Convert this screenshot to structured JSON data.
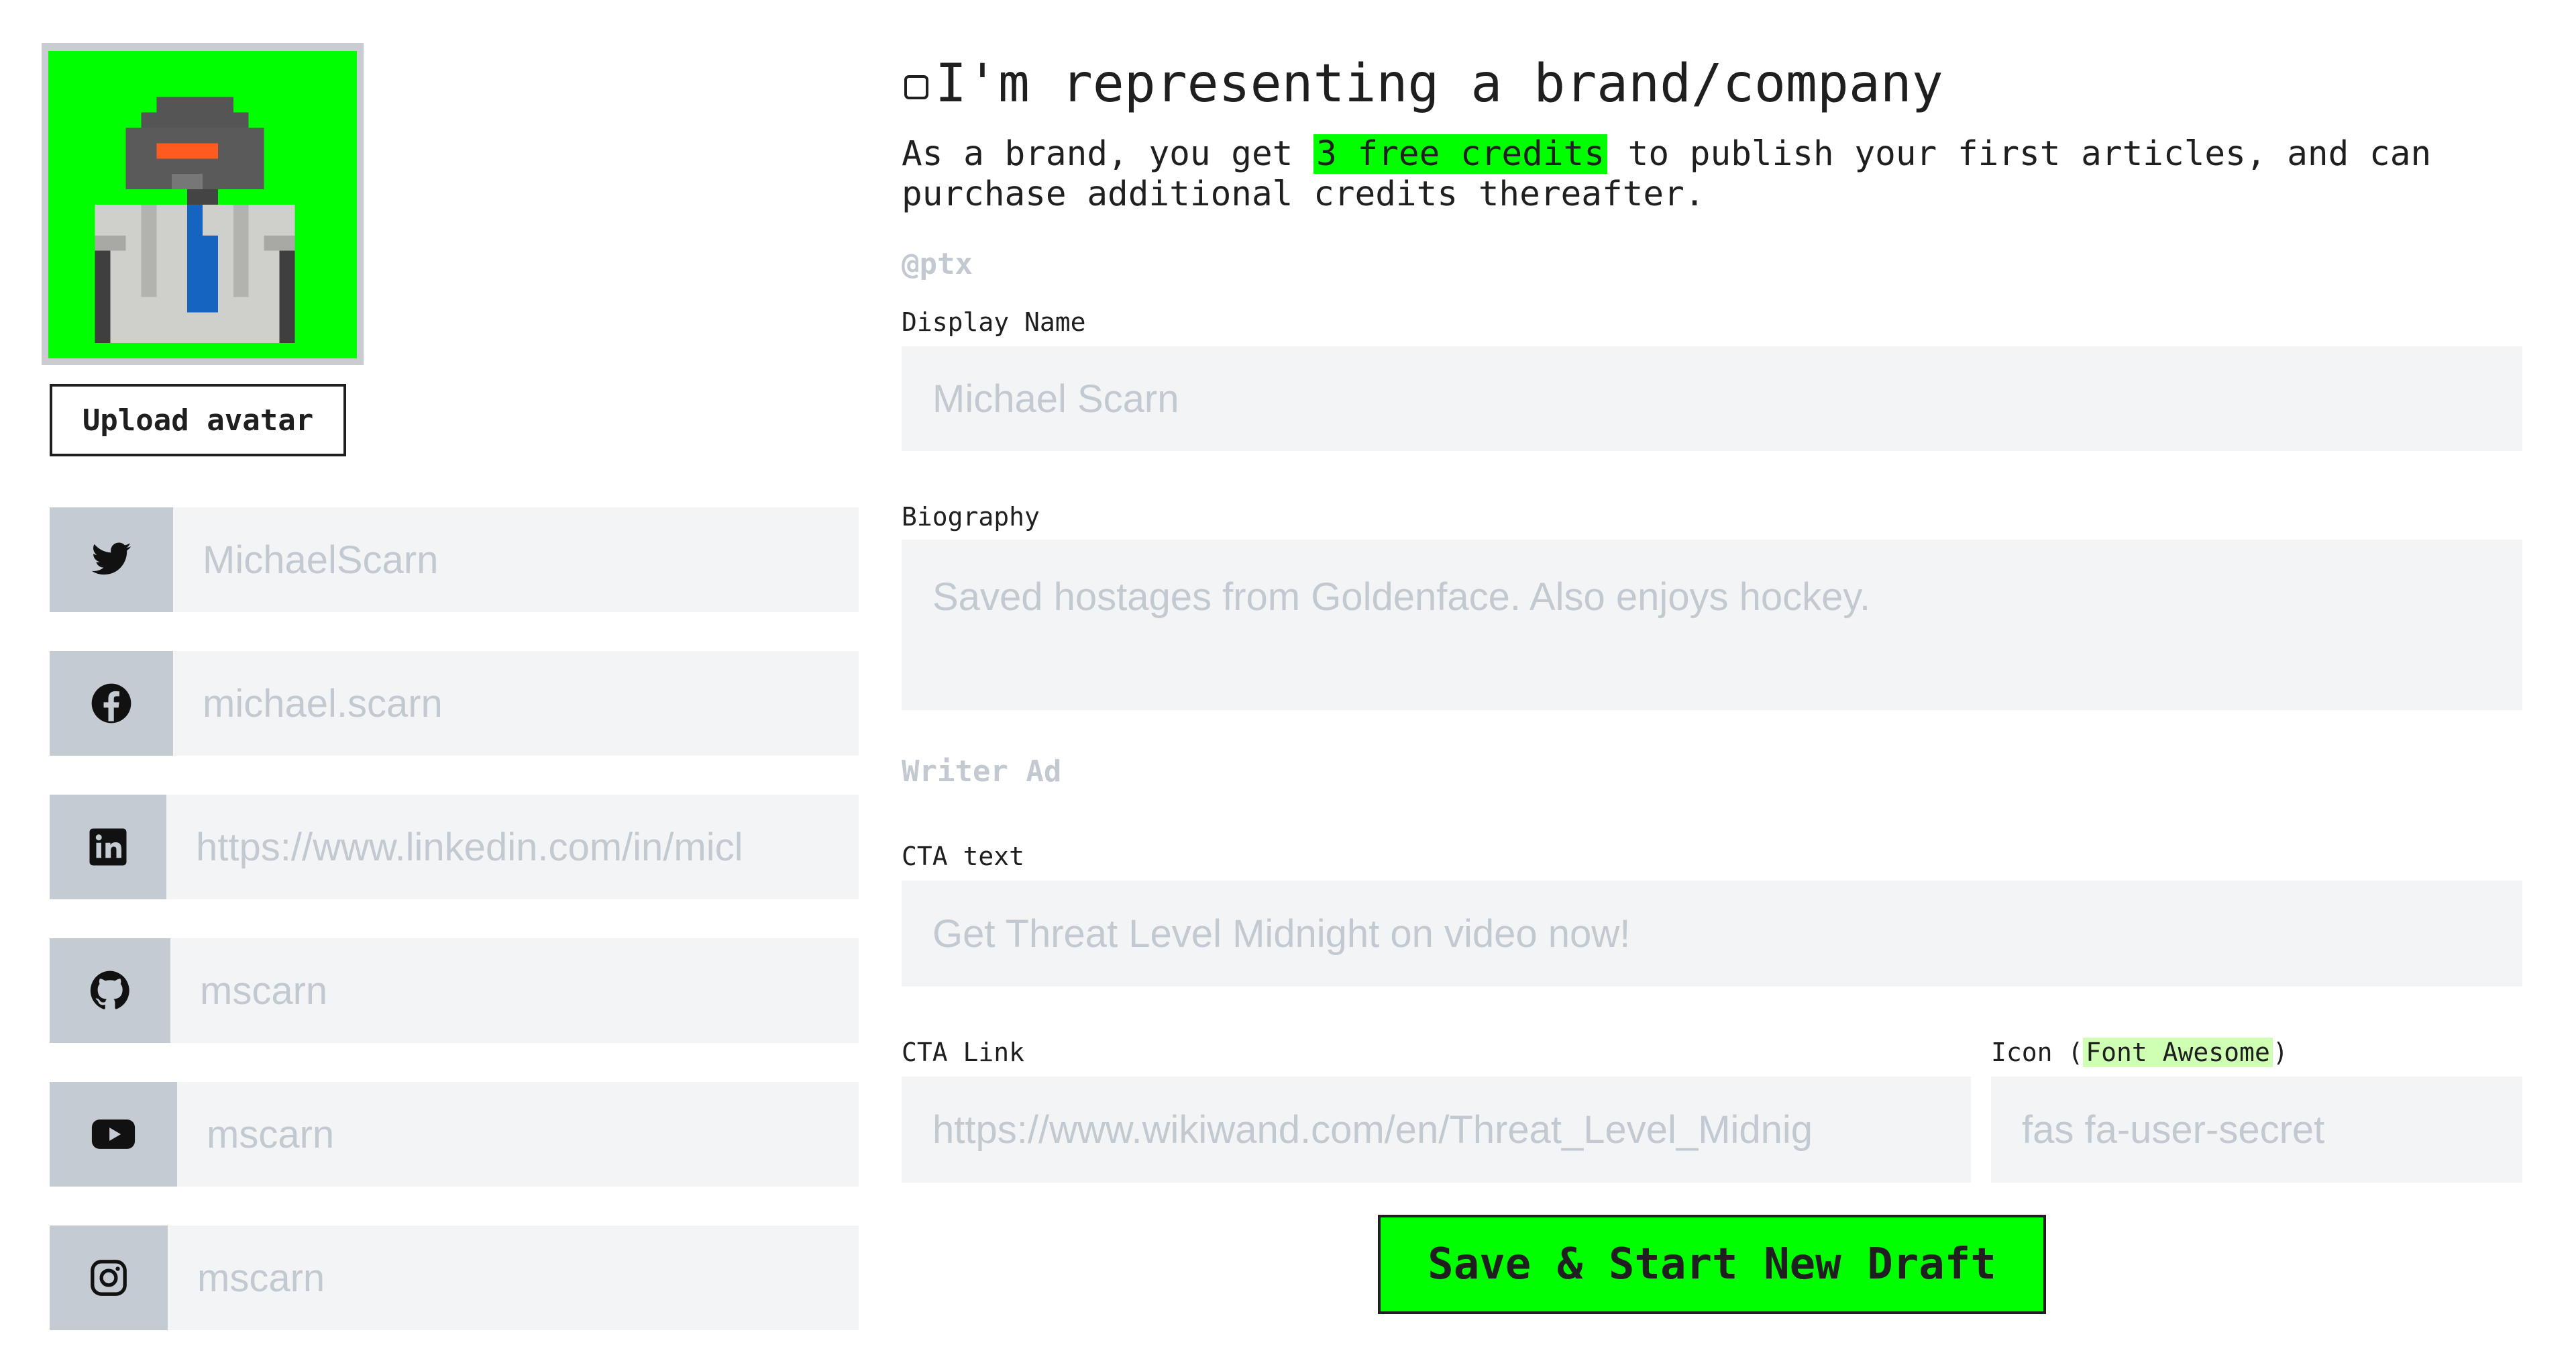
{
  "avatar": {
    "upload_label": "Upload avatar"
  },
  "social": [
    {
      "icon": "twitter-icon",
      "value": "MichaelScarn"
    },
    {
      "icon": "facebook-icon",
      "value": "michael.scarn"
    },
    {
      "icon": "linkedin-icon",
      "value": "https://www.linkedin.com/in/micl"
    },
    {
      "icon": "github-icon",
      "value": "mscarn"
    },
    {
      "icon": "youtube-icon",
      "value": "mscarn"
    },
    {
      "icon": "instagram-icon",
      "value": "mscarn"
    }
  ],
  "brand": {
    "checkbox_label": "I'm representing a brand/company",
    "desc_before": "As a brand, you get ",
    "desc_highlight": "3 free credits",
    "desc_after": " to publish your first articles, and can purchase additional credits thereafter."
  },
  "profile": {
    "handle": "@ptx",
    "display_name_label": "Display Name",
    "display_name_value": "Michael Scarn",
    "bio_label": "Biography",
    "bio_value": "Saved hostages from Goldenface. Also enjoys hockey."
  },
  "writer_ad": {
    "title": "Writer Ad",
    "cta_text_label": "CTA text",
    "cta_text_value": "Get Threat Level Midnight on video now!",
    "cta_link_label": "CTA Link",
    "cta_link_value": "https://www.wikiwand.com/en/Threat_Level_Midnig",
    "icon_label_prefix": "Icon (",
    "icon_label_link": "Font Awesome",
    "icon_label_suffix": ")",
    "icon_value": "fas fa-user-secret"
  },
  "actions": {
    "save_label": "Save & Start New Draft"
  },
  "colors": {
    "accent": "#00ff00",
    "input_bg": "#f3f4f6",
    "icon_box_bg": "#c4cbd3",
    "placeholder_text": "#c3c9d0"
  }
}
